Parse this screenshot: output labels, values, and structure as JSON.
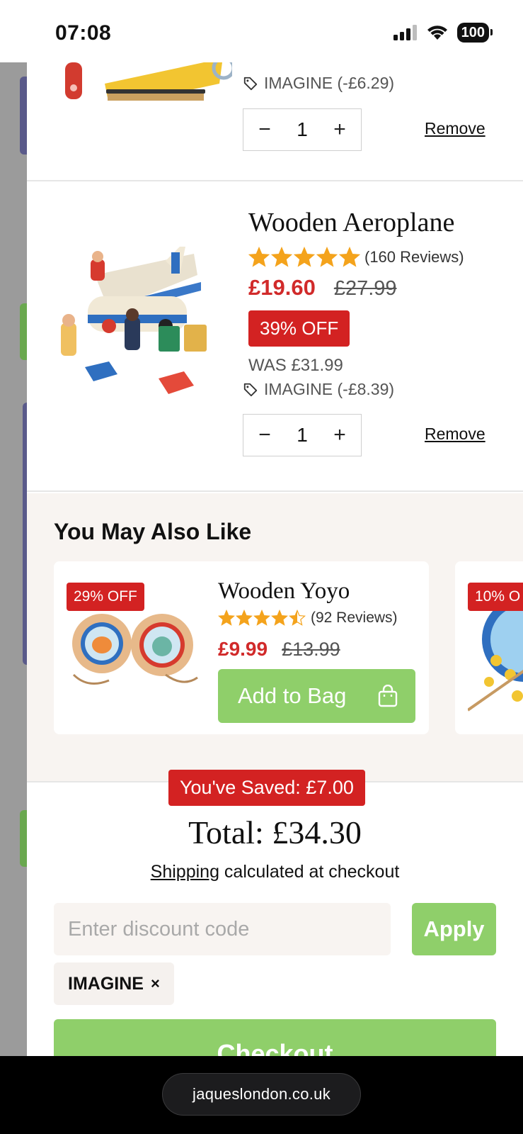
{
  "status_bar": {
    "time": "07:08",
    "battery": "100"
  },
  "cart": {
    "items": [
      {
        "coupon_text": "IMAGINE (-£6.29)",
        "quantity": "1",
        "remove_label": "Remove"
      },
      {
        "title": "Wooden Aeroplane",
        "rating": 5,
        "reviews": "(160 Reviews)",
        "price": "£19.60",
        "original_price": "£27.99",
        "discount_badge": "39% OFF",
        "was_text": "WAS £31.99",
        "coupon_text": "IMAGINE (-£8.39)",
        "quantity": "1",
        "remove_label": "Remove"
      }
    ],
    "qty_minus": "−",
    "qty_plus": "+"
  },
  "recommendations": {
    "heading": "You May Also Like",
    "items": [
      {
        "badge": "29% OFF",
        "title": "Wooden Yoyo",
        "rating": 4.5,
        "reviews": "(92 Reviews)",
        "price": "£9.99",
        "original_price": "£13.99",
        "button_label": "Add to Bag"
      },
      {
        "badge": "10% O"
      }
    ]
  },
  "summary": {
    "saved_badge": "You've Saved: £7.00",
    "total": "Total: £34.30",
    "shipping_link": "Shipping",
    "shipping_rest": " calculated at checkout",
    "discount_placeholder": "Enter discount code",
    "apply_label": "Apply",
    "applied_code": "IMAGINE",
    "applied_code_remove": "×",
    "checkout_label": "Checkout"
  },
  "browser": {
    "url": "jaqueslondon.co.uk"
  },
  "colors": {
    "accent_green": "#8fcf6a",
    "sale_red": "#d32222",
    "price_red": "#d12a2a",
    "star_orange": "#f4a31c",
    "panel_beige": "#f8f4f1"
  }
}
